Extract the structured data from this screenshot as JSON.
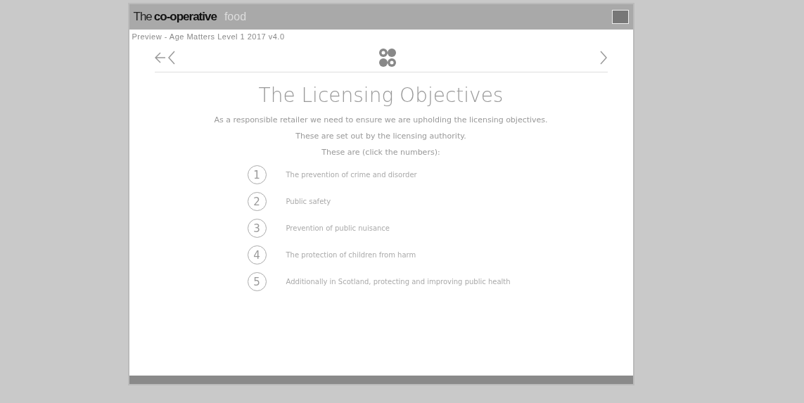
{
  "header": {
    "brand": "The",
    "brand_bold": "co-operative",
    "brand_sub": "food"
  },
  "course": {
    "title": "Preview - Age Matters Level 1 2017 v4.0"
  },
  "slide": {
    "heading": "The Licensing Objectives",
    "intro": [
      "As a responsible retailer we need to ensure we are upholding the licensing objectives.",
      "These are set out by the licensing authority.",
      "These are (click the numbers):"
    ],
    "objectives": [
      {
        "number": "1",
        "text": "The prevention of crime and disorder"
      },
      {
        "number": "2",
        "text": "Public safety"
      },
      {
        "number": "3",
        "text": "Prevention of public nuisance"
      },
      {
        "number": "4",
        "text": "The protection of children from harm"
      },
      {
        "number": "5",
        "text": "Additionally in Scotland, protecting and improving public health"
      }
    ]
  }
}
